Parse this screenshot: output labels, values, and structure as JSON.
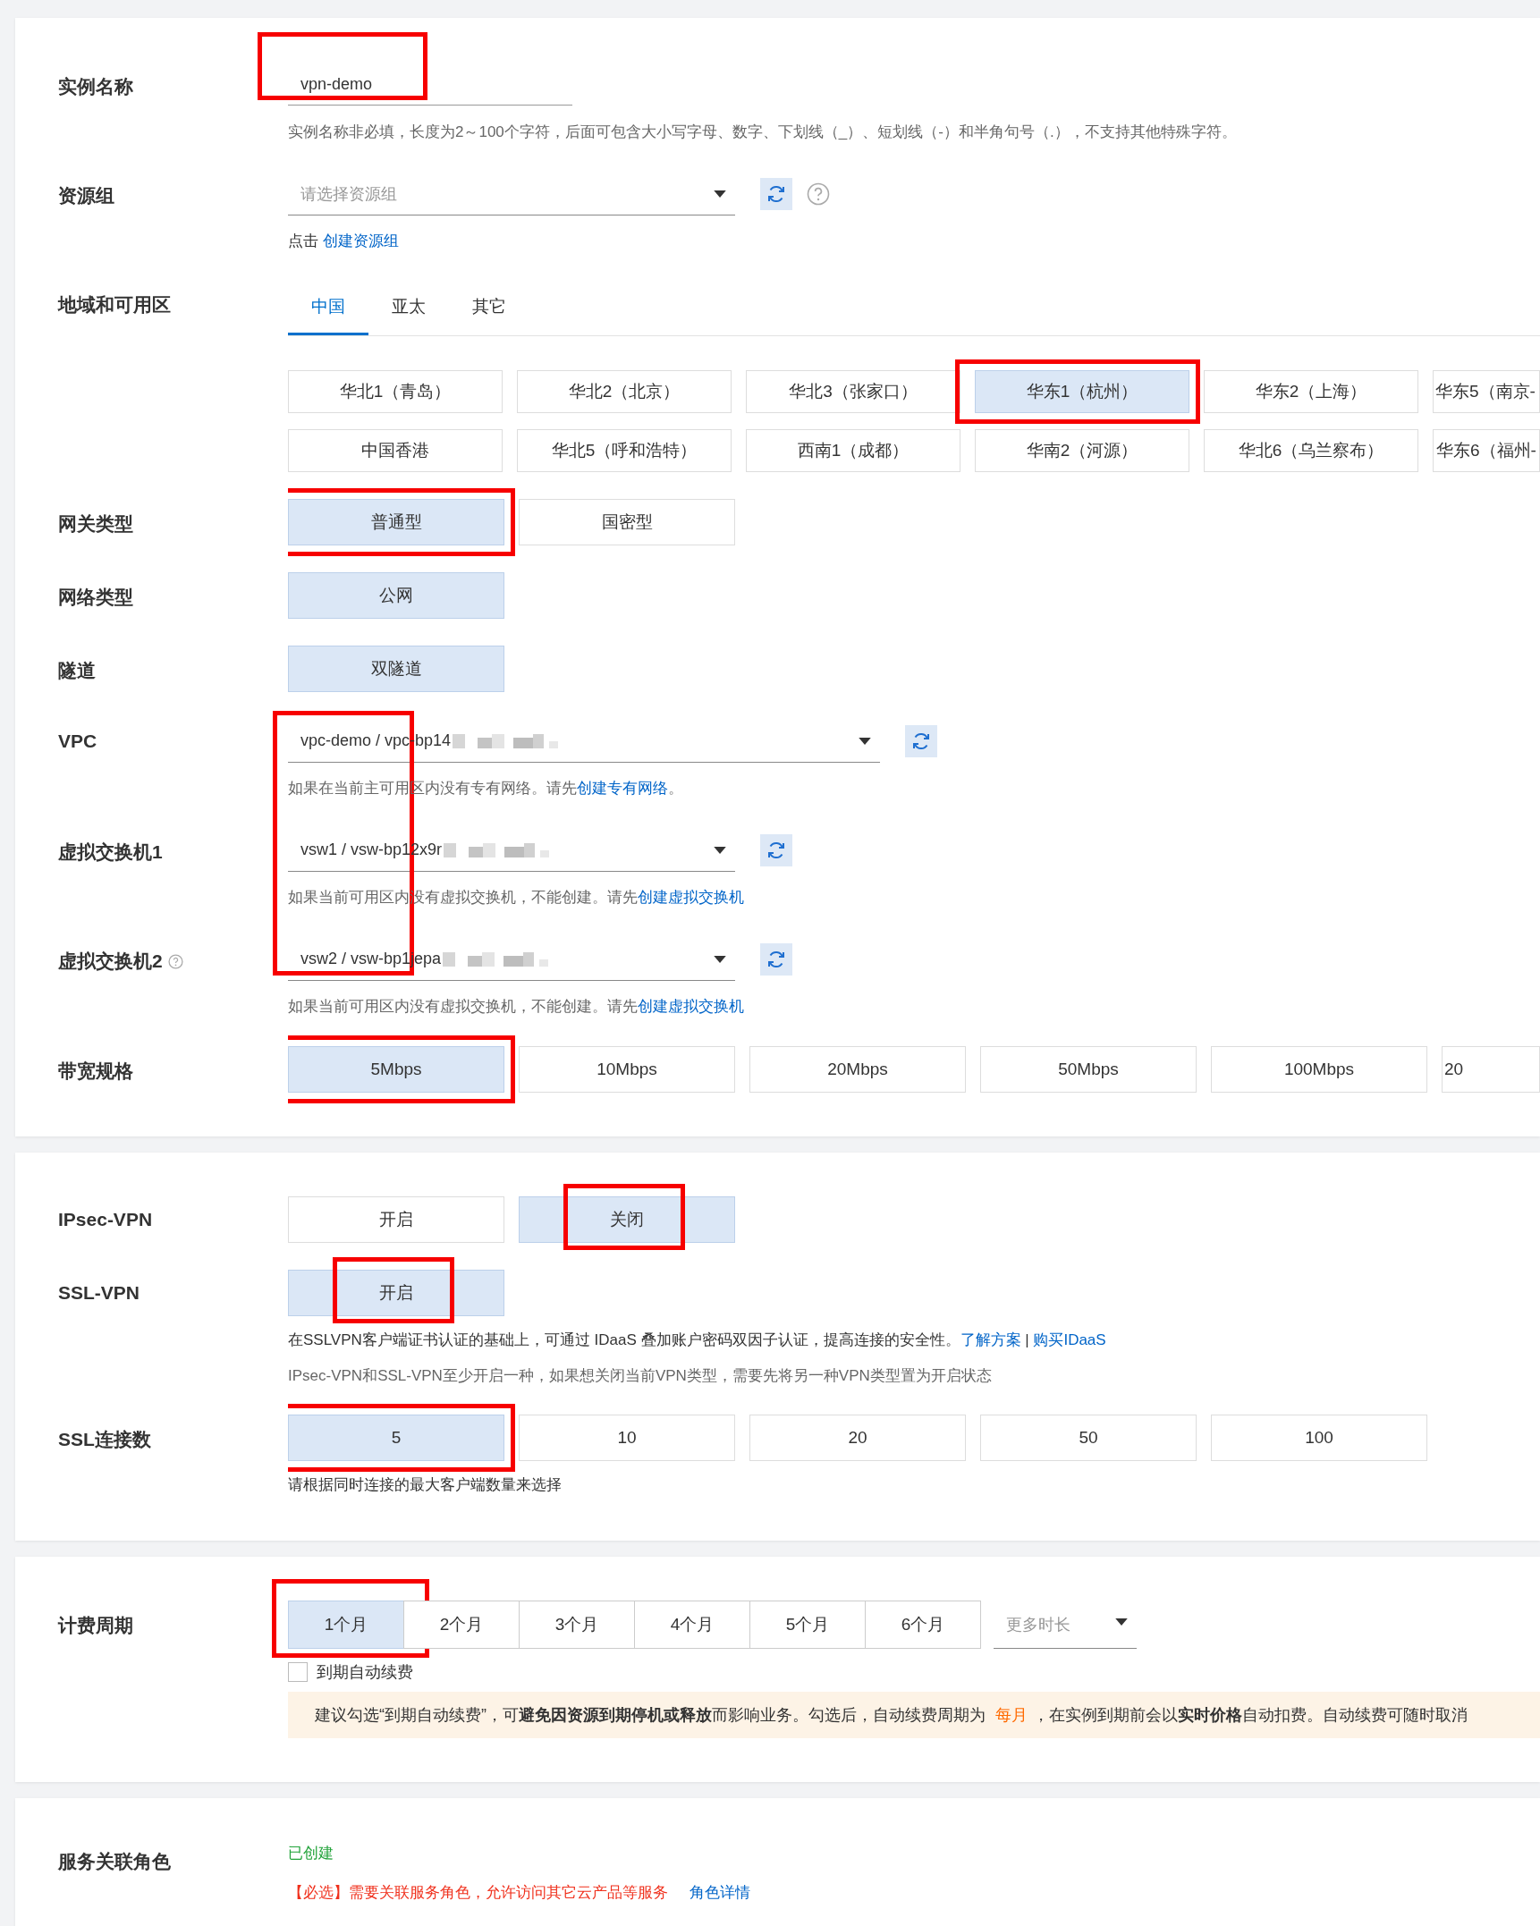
{
  "cards": [
    {
      "rows": [
        {
          "kind": "input",
          "label": "实例名称",
          "value": "vpn-demo",
          "annotated": true,
          "notes": [
            {
              "kind": "muted",
              "parts": [
                {
                  "kind": "text",
                  "text": "实例名称非必填，长度为2～100个字符，后面可包含大小写字母、数字、下划线（_）、短划线（-）和半角句号（.），不支持其他特殊字符。"
                }
              ]
            }
          ]
        },
        {
          "kind": "select",
          "label": "资源组",
          "placeholder": "请选择资源组",
          "help": true,
          "notes": [
            {
              "kind": "dark",
              "parts": [
                {
                  "kind": "text",
                  "text": "点击 "
                },
                {
                  "kind": "link",
                  "text": "创建资源组"
                }
              ]
            }
          ]
        },
        {
          "kind": "region",
          "label": "地域和可用区",
          "tabs": [
            {
              "label": "中国",
              "selected": true
            },
            {
              "label": "亚太",
              "selected": false
            },
            {
              "label": "其它",
              "selected": false
            }
          ],
          "options": [
            {
              "label": "华北1（青岛）",
              "selected": false,
              "annotated": false
            },
            {
              "label": "华北2（北京）",
              "selected": false,
              "annotated": false
            },
            {
              "label": "华北3（张家口）",
              "selected": false,
              "annotated": false
            },
            {
              "label": "华东1（杭州）",
              "selected": true,
              "annotated": true
            },
            {
              "label": "华东2（上海）",
              "selected": false,
              "annotated": false
            },
            {
              "label": "华东5（南京-",
              "selected": false,
              "annotated": false
            },
            {
              "label": "中国香港",
              "selected": false,
              "annotated": false
            },
            {
              "label": "华北5（呼和浩特）",
              "selected": false,
              "annotated": false
            },
            {
              "label": "西南1（成都）",
              "selected": false,
              "annotated": false
            },
            {
              "label": "华南2（河源）",
              "selected": false,
              "annotated": false
            },
            {
              "label": "华北6（乌兰察布）",
              "selected": false,
              "annotated": false
            },
            {
              "label": "华东6（福州-",
              "selected": false,
              "annotated": false
            }
          ]
        },
        {
          "kind": "options",
          "label": "网关类型",
          "options": [
            {
              "label": "普通型",
              "selected": true,
              "annotated": true
            },
            {
              "label": "国密型",
              "selected": false,
              "annotated": false
            }
          ]
        },
        {
          "kind": "options",
          "label": "网络类型",
          "options": [
            {
              "label": "公网",
              "selected": true,
              "annotated": false
            }
          ]
        },
        {
          "kind": "options",
          "label": "隧道",
          "options": [
            {
              "label": "双隧道",
              "selected": true,
              "annotated": false
            }
          ]
        },
        {
          "kind": "network",
          "annotated": true,
          "selects": [
            {
              "label": "VPC",
              "value": "vpc-demo / vpc-bp14",
              "notes": [
                {
                  "kind": "muted",
                  "parts": [
                    {
                      "kind": "text",
                      "text": "如果在当前主可用区内没有专有网络。请先"
                    },
                    {
                      "kind": "link",
                      "text": "创建专有网络"
                    },
                    {
                      "kind": "text",
                      "text": "。"
                    }
                  ]
                }
              ]
            },
            {
              "label": "虚拟交换机1",
              "value": "vsw1 / vsw-bp12x9r",
              "notes": [
                {
                  "kind": "muted",
                  "parts": [
                    {
                      "kind": "text",
                      "text": "如果当前可用区内没有虚拟交换机，不能创建。请先"
                    },
                    {
                      "kind": "link",
                      "text": "创建虚拟交换机"
                    }
                  ]
                }
              ]
            },
            {
              "label": "虚拟交换机2",
              "help": true,
              "value": "vsw2 / vsw-bp1jepa",
              "notes": [
                {
                  "kind": "muted",
                  "parts": [
                    {
                      "kind": "text",
                      "text": "如果当前可用区内没有虚拟交换机，不能创建。请先"
                    },
                    {
                      "kind": "link",
                      "text": "创建虚拟交换机"
                    }
                  ]
                }
              ]
            }
          ]
        },
        {
          "kind": "options",
          "label": "带宽规格",
          "options": [
            {
              "label": "5Mbps",
              "selected": true,
              "annotated": true
            },
            {
              "label": "10Mbps",
              "selected": false,
              "annotated": false
            },
            {
              "label": "20Mbps",
              "selected": false,
              "annotated": false
            },
            {
              "label": "50Mbps",
              "selected": false,
              "annotated": false
            },
            {
              "label": "100Mbps",
              "selected": false,
              "annotated": false
            },
            {
              "label": "20",
              "selected": false,
              "annotated": false
            }
          ]
        }
      ]
    },
    {
      "rows": [
        {
          "kind": "options",
          "label": "IPsec-VPN",
          "options": [
            {
              "label": "开启",
              "selected": false,
              "annotated": false
            },
            {
              "label": "关闭",
              "selected": true,
              "annotated": true
            }
          ]
        },
        {
          "kind": "options",
          "label": "SSL-VPN",
          "options": [
            {
              "label": "开启",
              "selected": true,
              "annotated": true
            }
          ],
          "notes": [
            {
              "kind": "dark",
              "parts": [
                {
                  "kind": "text",
                  "text": "在SSLVPN客户端证书认证的基础上，可通过 IDaaS 叠加账户密码双因子认证，提高连接的安全性。"
                },
                {
                  "kind": "link",
                  "text": "了解方案"
                },
                {
                  "kind": "text",
                  "text": " | "
                },
                {
                  "kind": "link",
                  "text": "购买IDaaS"
                }
              ]
            },
            {
              "kind": "muted",
              "parts": [
                {
                  "kind": "text",
                  "text": "IPsec-VPN和SSL-VPN至少开启一种，如果想关闭当前VPN类型，需要先将另一种VPN类型置为开启状态"
                }
              ]
            }
          ]
        },
        {
          "kind": "options",
          "label": "SSL连接数",
          "options": [
            {
              "label": "5",
              "selected": true,
              "annotated": true
            },
            {
              "label": "10",
              "selected": false,
              "annotated": false
            },
            {
              "label": "20",
              "selected": false,
              "annotated": false
            },
            {
              "label": "50",
              "selected": false,
              "annotated": false
            },
            {
              "label": "100",
              "selected": false,
              "annotated": false
            }
          ],
          "notes": [
            {
              "kind": "dark",
              "parts": [
                {
                  "kind": "text",
                  "text": "请根据同时连接的最大客户端数量来选择"
                }
              ]
            }
          ]
        }
      ]
    },
    {
      "rows": [
        {
          "kind": "period",
          "label": "计费周期",
          "options": [
            {
              "label": "1个月",
              "selected": true,
              "annotated": true
            },
            {
              "label": "2个月",
              "selected": false,
              "annotated": false
            },
            {
              "label": "3个月",
              "selected": false,
              "annotated": false
            },
            {
              "label": "4个月",
              "selected": false,
              "annotated": false
            },
            {
              "label": "5个月",
              "selected": false,
              "annotated": false
            },
            {
              "label": "6个月",
              "selected": false,
              "annotated": false
            }
          ],
          "more": {
            "placeholder": "更多时长"
          },
          "checkbox": {
            "label": "到期自动续费",
            "checked": false
          },
          "notice": [
            {
              "kind": "text",
              "text": "建议勾选“到期自动续费”，可"
            },
            {
              "kind": "bold",
              "text": "避免因资源到期停机或释放"
            },
            {
              "kind": "text",
              "text": "而影响业务。勾选后，自动续费周期为 "
            },
            {
              "kind": "accent",
              "text": "每月"
            },
            {
              "kind": "text",
              "text": "，在实例到期前会以"
            },
            {
              "kind": "bold",
              "text": "实时价格"
            },
            {
              "kind": "text",
              "text": "自动扣费。自动续费可随时取消"
            }
          ]
        }
      ]
    },
    {
      "rows": [
        {
          "kind": "status",
          "label": "服务关联角色",
          "notes": [
            {
              "kind": "success",
              "parts": [
                {
                  "kind": "text",
                  "text": "已创建"
                }
              ]
            },
            {
              "kind": "danger",
              "parts": [
                {
                  "kind": "text",
                  "text": "【必选】需要关联服务角色，允许访问其它云产品等服务"
                },
                {
                  "kind": "link",
                  "text": "角色详情"
                }
              ]
            }
          ]
        }
      ]
    }
  ]
}
